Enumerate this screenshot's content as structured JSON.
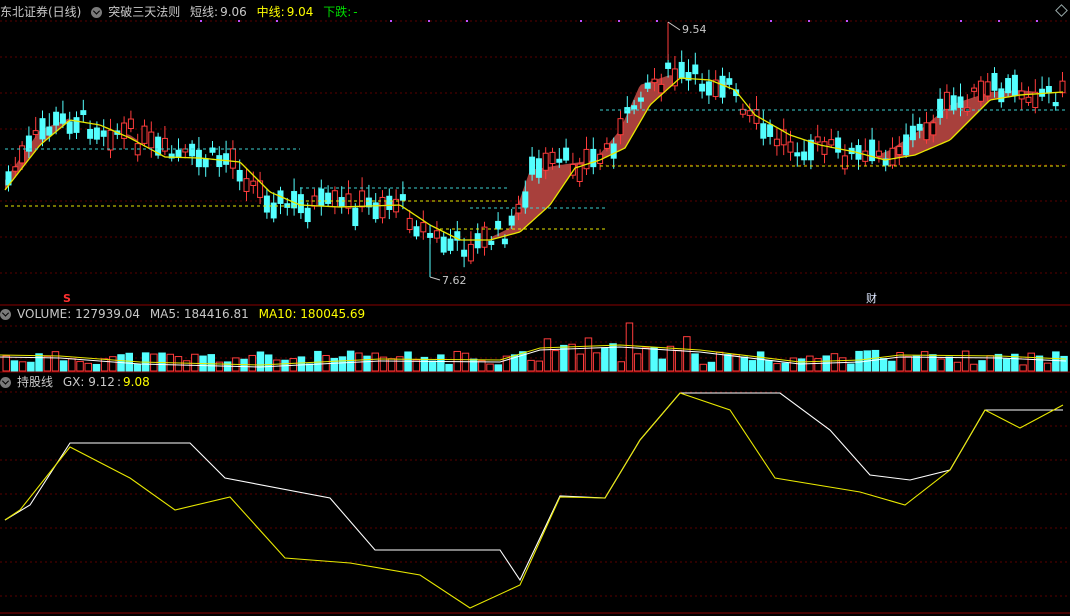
{
  "header": {
    "stock_name": "东北证券(日线)",
    "indicator_name": "突破三天法则",
    "short_label": "短线:",
    "short_value": "9.06",
    "mid_label": "中线:",
    "mid_value": "9.04",
    "trend_label": "下跌:",
    "trend_value": "-"
  },
  "price_panel": {
    "high_label": "9.54",
    "low_label": "7.62",
    "marker_s": "S",
    "marker_cai": "财"
  },
  "volume_panel": {
    "volume_label": "VOLUME: 127939.04",
    "ma5_label": "MA5: 184416.81",
    "ma10_label": "MA10: 180045.69"
  },
  "gx_panel": {
    "title": "持股线",
    "gx_label": "GX: 9.12",
    "gx_value2": "9.08"
  },
  "colors": {
    "up": "#ff3c3c",
    "down": "#54ffff",
    "band": "#a8403c",
    "ma_yellow": "#e8e800",
    "ma_green": "#3cd03c",
    "white_line": "#ffffff",
    "header_green": "#00dd00",
    "header_yellow": "#ffff00",
    "grid": "#5a0000"
  },
  "icons": [
    "collapse-arrow-icon",
    "diamond-icon"
  ]
}
